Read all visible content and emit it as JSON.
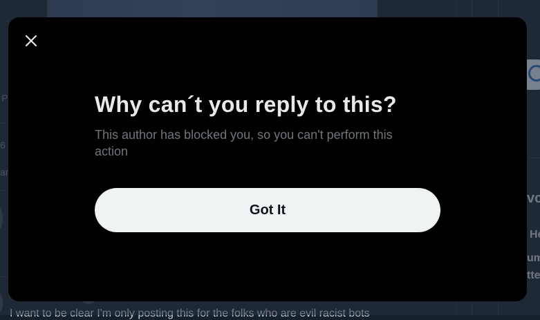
{
  "dialog": {
    "title": "Why can´t you reply to this?",
    "description": "This author has blocked you, so you can't perform this action",
    "confirm_label": "Got It",
    "close_icon": "close-icon"
  },
  "background": {
    "tweet_text": "I want to be clear I'm only posting this for the folks who are evil racist bots",
    "fragments": [
      "P",
      "6",
      "ar",
      "vc",
      "He",
      "um",
      "tte"
    ]
  },
  "colors": {
    "modal_bg": "#000000",
    "title": "#e7e9ea",
    "description": "#71767b",
    "button_bg": "#eff3f4",
    "button_text": "#0f1419"
  }
}
